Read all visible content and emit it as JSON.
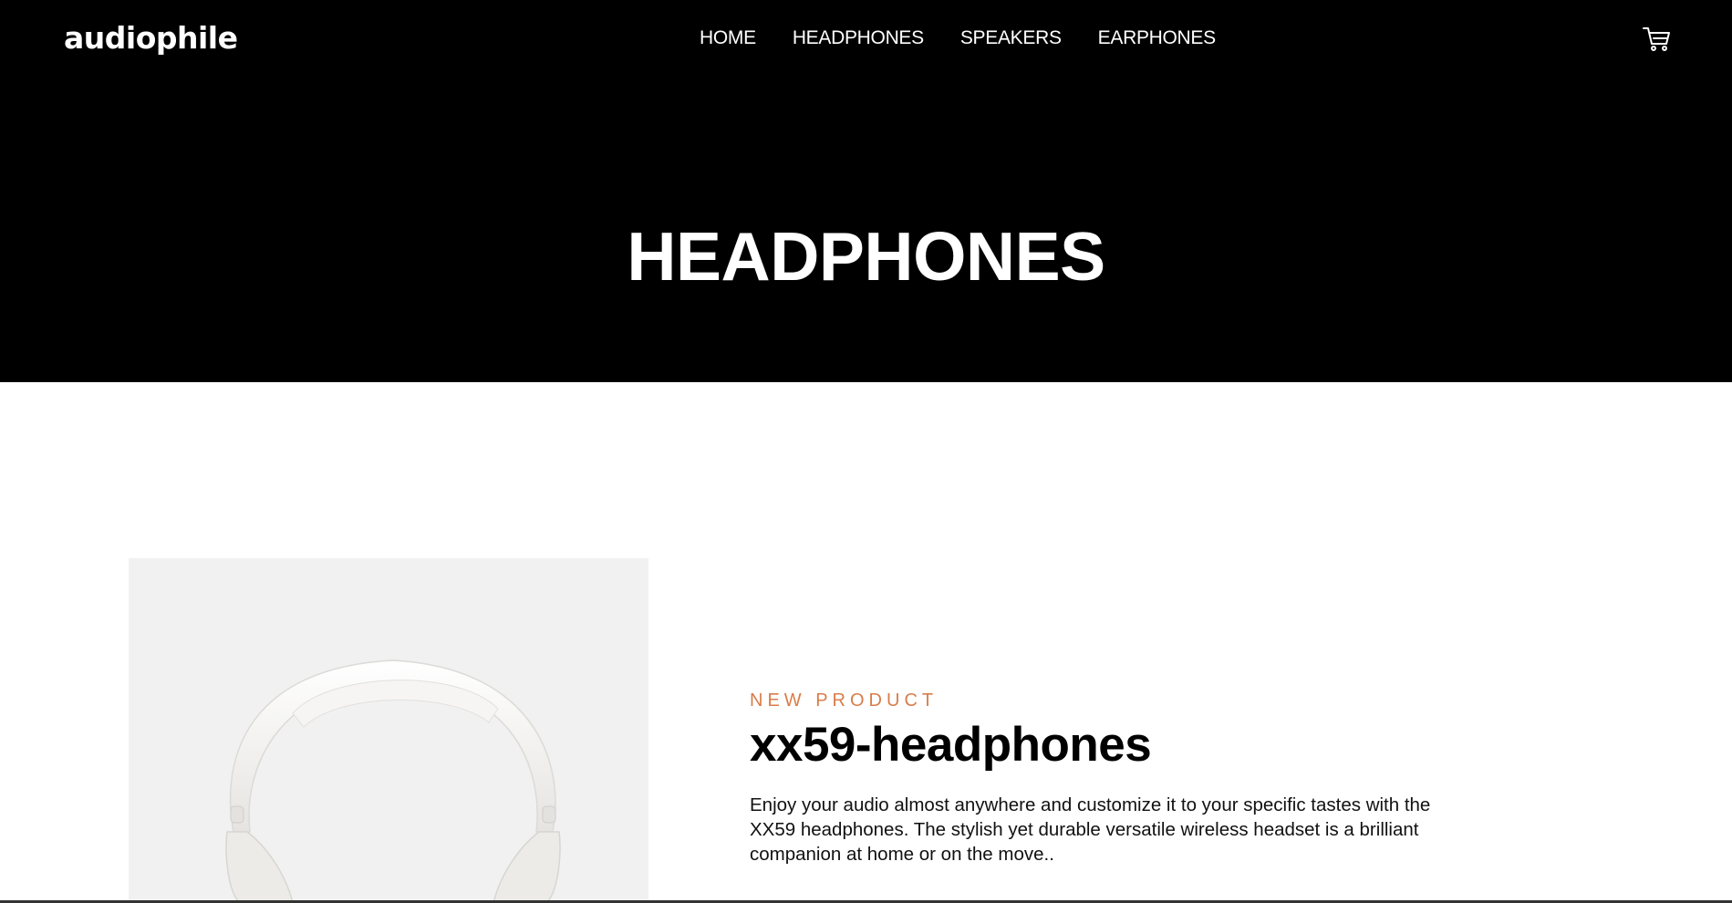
{
  "header": {
    "logo": "audiophile",
    "nav": [
      "HOME",
      "HEADPHONES",
      "SPEAKERS",
      "EARPHONES"
    ],
    "cart_icon": "cart-icon",
    "title": "HEADPHONES"
  },
  "product": {
    "overline": "NEW PRODUCT",
    "name": "xx59-headphones",
    "description": "Enjoy your audio almost anywhere and customize it to your specific tastes with the XX59 headphones. The stylish yet durable versatile wireless headset is a brilliant companion at home or on the move.."
  },
  "colors": {
    "header_bg": "#000000",
    "accent": "#D87D4A",
    "image_bg": "#F1F1F1"
  }
}
